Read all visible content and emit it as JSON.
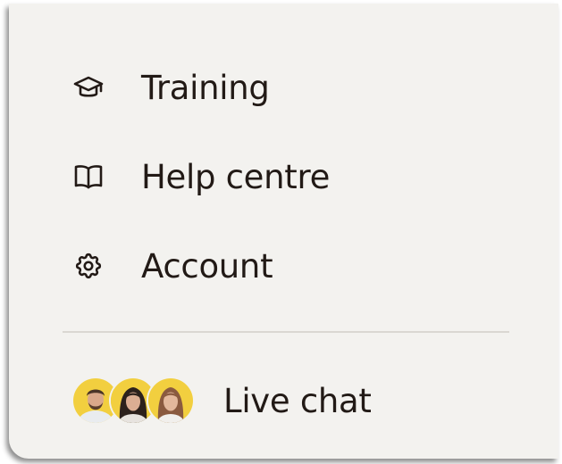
{
  "menu": {
    "items": [
      {
        "label": "Training",
        "icon": "graduation-cap-icon"
      },
      {
        "label": "Help centre",
        "icon": "open-book-icon"
      },
      {
        "label": "Account",
        "icon": "gear-icon"
      }
    ],
    "live_chat": {
      "label": "Live chat",
      "avatars": [
        "support-agent-avatar",
        "support-agent-avatar",
        "support-agent-avatar"
      ]
    }
  },
  "colors": {
    "panel_background": "#f3f2ef",
    "text": "#221a16",
    "divider": "#dad7d2",
    "avatar_background": "#f2cf3f"
  }
}
